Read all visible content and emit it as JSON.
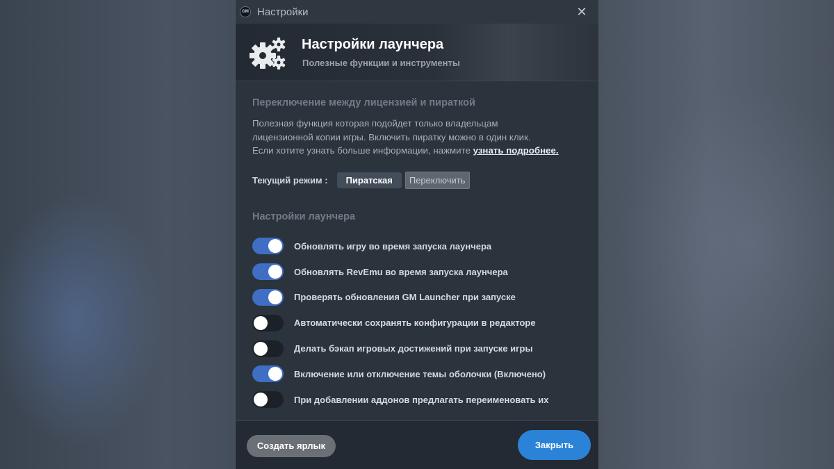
{
  "window": {
    "title": "Настройки",
    "logo_text": "GM",
    "close_glyph": "✕"
  },
  "header": {
    "title": "Настройки лаунчера",
    "subtitle": "Полезные функции и инструменты",
    "icon": "gears-icon"
  },
  "license_section": {
    "title": "Переключение между лицензией и пираткой",
    "desc_line1": "Полезная функция которая подойдет только владельцам",
    "desc_line2": "лицензионной копии игры. Включить пиратку можно в один клик.",
    "desc_line3": "Если хотите узнать больше информации, нажмите ",
    "learn_more": "узнать подробнее.",
    "mode_label": "Текущий режим :",
    "mode_value": "Пиратская",
    "switch_label": "Переключить"
  },
  "launcher_section": {
    "title": "Настройки лаунчера",
    "toggles": [
      {
        "label": "Обновлять игру во время запуска лаунчера",
        "on": true
      },
      {
        "label": "Обновлять RevEmu во время запуска лаунчера",
        "on": true
      },
      {
        "label": "Проверять обновления GM Launcher при запуске",
        "on": true
      },
      {
        "label": "Автоматически сохранять конфигурации в редакторе",
        "on": false
      },
      {
        "label": "Делать бэкап игровых достижений при запуске игры",
        "on": false
      },
      {
        "label": "Включение или отключение темы оболочки (Включено)",
        "on": true
      },
      {
        "label": "При добавлении аддонов предлагать переименовать их",
        "on": false
      }
    ]
  },
  "footer": {
    "shortcut_button": "Создать ярлык",
    "close_button": "Закрыть"
  },
  "colors": {
    "accent": "#2b83d7",
    "toggle_on": "#3f6fc4",
    "toggle_off": "#1c2128",
    "panel": "#2b333d"
  }
}
